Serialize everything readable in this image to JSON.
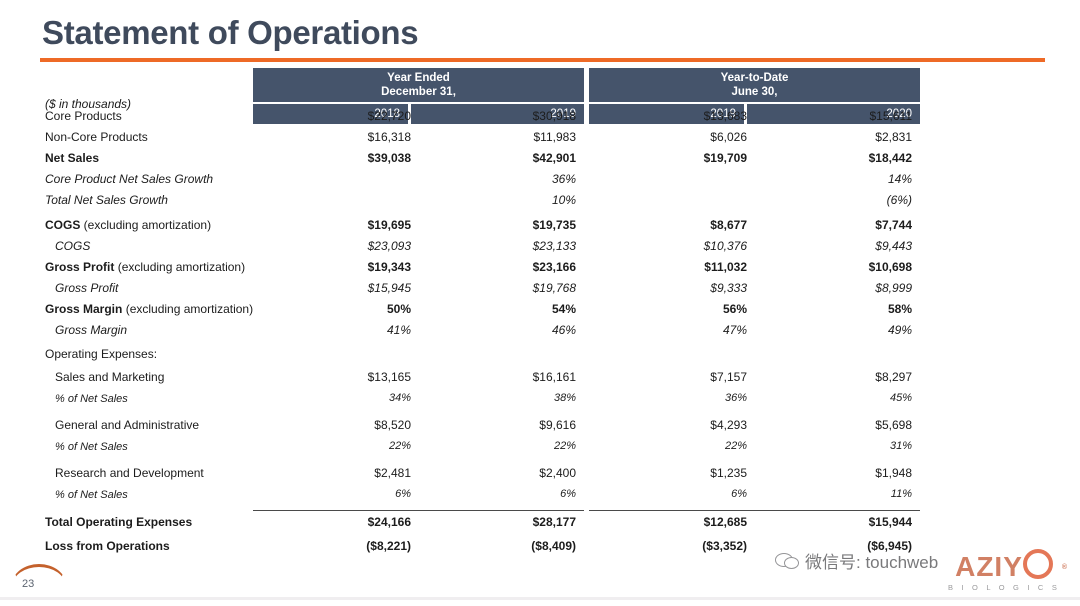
{
  "slide": {
    "title": "Statement of Operations",
    "page_number": "23",
    "accent_color": "#ee6a26",
    "title_color": "#3f4a5c",
    "header_fill": "#45546b"
  },
  "watermark": {
    "icon": "wechat-icon",
    "text": "微信号: touchweb"
  },
  "logo": {
    "name": "AZIY",
    "name_suffix": "O",
    "tagline": "B I O L O G I C S",
    "registered": "®"
  },
  "table": {
    "group_headers": [
      {
        "line1": "Year Ended",
        "line2": "December 31,"
      },
      {
        "line1": "Year-to-Date",
        "line2": "June 30,"
      }
    ],
    "year_headers": [
      "2018",
      "2019",
      "2019",
      "2020"
    ],
    "units_label": "($ in thousands)",
    "rows": [
      {
        "label": "Core Products",
        "style": "normal",
        "indent": 0,
        "values": [
          "$22,720",
          "$30,918",
          "$13,683",
          "$15,611"
        ]
      },
      {
        "label": "Non-Core Products",
        "style": "normal",
        "indent": 0,
        "values": [
          "$16,318",
          "$11,983",
          "$6,026",
          "$2,831"
        ]
      },
      {
        "label": "Net Sales",
        "style": "bold",
        "indent": 0,
        "values": [
          "$39,038",
          "$42,901",
          "$19,709",
          "$18,442"
        ]
      },
      {
        "label": "Core Product Net Sales Growth",
        "style": "italic",
        "indent": 0,
        "values": [
          "",
          "36%",
          "",
          "14%"
        ]
      },
      {
        "label": "Total Net Sales Growth",
        "style": "italic",
        "indent": 0,
        "values": [
          "",
          "10%",
          "",
          "(6%)"
        ]
      },
      {
        "label": "COGS",
        "label_suffix": " (excluding amortization)",
        "style": "bold-mixed",
        "indent": 0,
        "values": [
          "$19,695",
          "$19,735",
          "$8,677",
          "$7,744"
        ]
      },
      {
        "label": "COGS",
        "style": "italic",
        "indent": 1,
        "values": [
          "$23,093",
          "$23,133",
          "$10,376",
          "$9,443"
        ]
      },
      {
        "label": "Gross Profit",
        "label_suffix": " (excluding amortization)",
        "style": "bold-mixed",
        "indent": 0,
        "values": [
          "$19,343",
          "$23,166",
          "$11,032",
          "$10,698"
        ]
      },
      {
        "label": "Gross Profit",
        "style": "italic",
        "indent": 1,
        "values": [
          "$15,945",
          "$19,768",
          "$9,333",
          "$8,999"
        ]
      },
      {
        "label": "Gross Margin",
        "label_suffix": " (excluding amortization)",
        "style": "bold-mixed",
        "indent": 0,
        "values": [
          "50%",
          "54%",
          "56%",
          "58%"
        ]
      },
      {
        "label": "Gross Margin",
        "style": "italic",
        "indent": 1,
        "values": [
          "41%",
          "46%",
          "47%",
          "49%"
        ]
      },
      {
        "label": "Operating Expenses:",
        "style": "normal",
        "indent": 0,
        "values": [
          "",
          "",
          "",
          ""
        ]
      },
      {
        "label": "Sales and Marketing",
        "style": "normal",
        "indent": 2,
        "values": [
          "$13,165",
          "$16,161",
          "$7,157",
          "$8,297"
        ]
      },
      {
        "label": "% of Net Sales",
        "style": "pct-italic",
        "indent": 2,
        "values": [
          "34%",
          "38%",
          "36%",
          "45%"
        ]
      },
      {
        "label": "General and Administrative",
        "style": "normal",
        "indent": 2,
        "values": [
          "$8,520",
          "$9,616",
          "$4,293",
          "$5,698"
        ]
      },
      {
        "label": "% of Net Sales",
        "style": "pct-italic",
        "indent": 2,
        "values": [
          "22%",
          "22%",
          "22%",
          "31%"
        ]
      },
      {
        "label": "Research and Development",
        "style": "normal",
        "indent": 2,
        "values": [
          "$2,481",
          "$2,400",
          "$1,235",
          "$1,948"
        ]
      },
      {
        "label": "% of Net Sales",
        "style": "pct-italic",
        "indent": 2,
        "values": [
          "6%",
          "6%",
          "6%",
          "11%"
        ]
      },
      {
        "label": "Total Operating Expenses",
        "style": "bold",
        "indent": 0,
        "values": [
          "$24,166",
          "$28,177",
          "$12,685",
          "$15,944"
        ]
      },
      {
        "label": "Loss from Operations",
        "style": "bold",
        "indent": 0,
        "values": [
          "($8,221)",
          "($8,409)",
          "($3,352)",
          "($6,945)"
        ]
      }
    ]
  }
}
